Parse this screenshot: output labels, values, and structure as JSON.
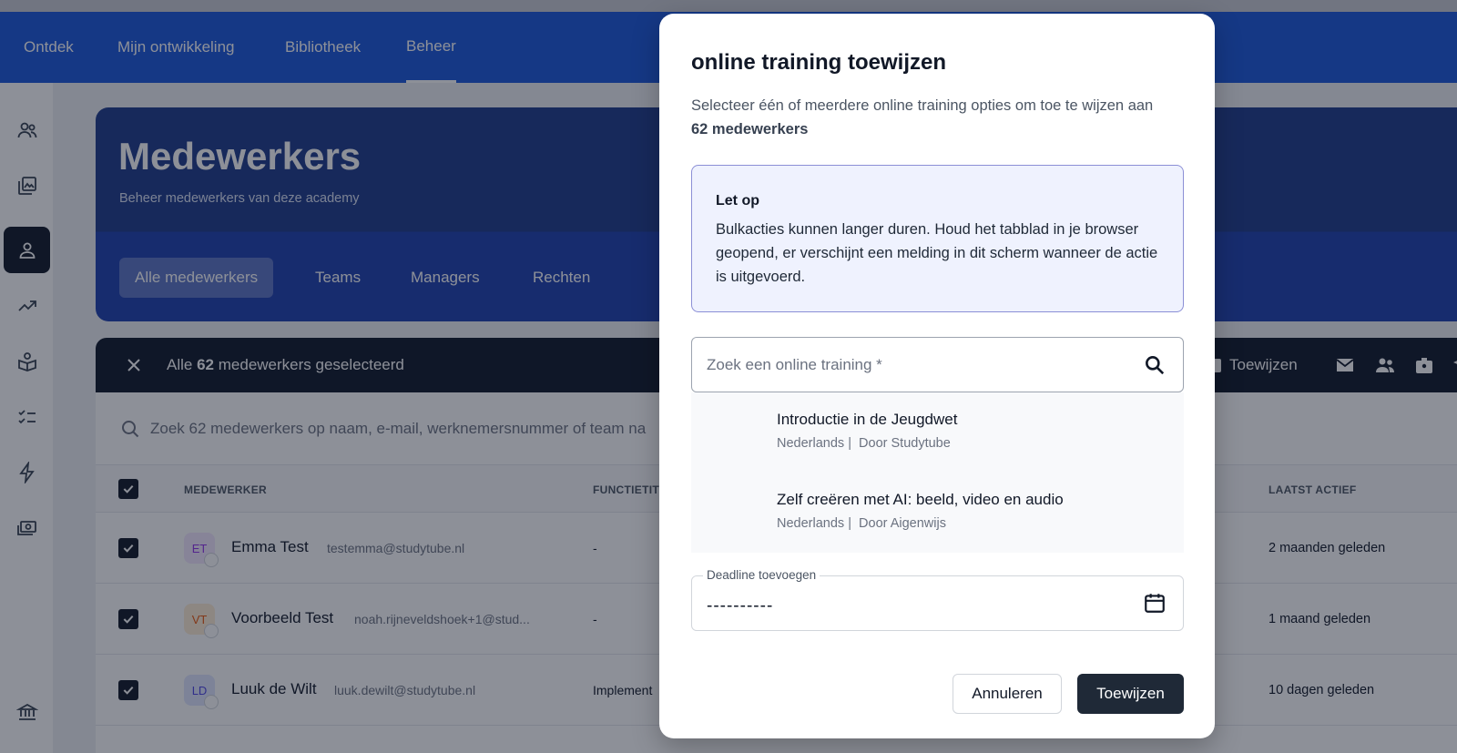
{
  "topnav": {
    "items": [
      "Ontdek",
      "Mijn ontwikkeling",
      "Bibliotheek",
      "Beheer"
    ],
    "active_index": 3
  },
  "sidebar": {
    "icons": [
      "users-icon",
      "library-icon",
      "person-icon",
      "trending-icon",
      "learning-icon",
      "checklist-icon",
      "bolt-icon",
      "money-icon",
      "bank-icon"
    ],
    "active": "person-icon"
  },
  "header": {
    "title": "Medewerkers",
    "subtitle": "Beheer medewerkers van deze academy",
    "tabs": [
      "Alle medewerkers",
      "Teams",
      "Managers",
      "Rechten"
    ],
    "active_tab": 0
  },
  "selection_bar": {
    "prefix": "Alle",
    "count": "62",
    "suffix": "medewerkers geselecteerd",
    "assign_label": "Toewijzen"
  },
  "table": {
    "search_placeholder": "Zoek 62 medewerkers op naam, e-mail, werknemersnummer of team na",
    "columns": {
      "employee": "MEDEWERKER",
      "function": "FUNCTIETIT",
      "last_active": "LAATST ACTIEF"
    },
    "rows": [
      {
        "initials": "ET",
        "name": "Emma Test",
        "email": "testemma@studytube.nl",
        "function": "-",
        "last_active": "2 maanden geleden",
        "avatar_bg": "#f3e8ff",
        "avatar_fg": "#9333ea"
      },
      {
        "initials": "VT",
        "name": "Voorbeeld Test",
        "email": "noah.rijneveldshoek+1@stud...",
        "function": "-",
        "last_active": "1 maand geleden",
        "avatar_bg": "#ffedd5",
        "avatar_fg": "#ea580c"
      },
      {
        "initials": "LD",
        "name": "Luuk de Wilt",
        "email": "luuk.dewilt@studytube.nl",
        "function": "Implement",
        "last_active": "10 dagen geleden",
        "avatar_bg": "#e0e7ff",
        "avatar_fg": "#4f46e5"
      }
    ]
  },
  "modal": {
    "title": "online training toewijzen",
    "description": "Selecteer één of meerdere online training opties om toe te wijzen aan",
    "description_bold": "62 medewerkers",
    "notice": {
      "title": "Let op",
      "body": "Bulkacties kunnen langer duren. Houd het tabblad in je browser geopend, er verschijnt een melding in dit scherm wanneer de actie is uitgevoerd."
    },
    "search": {
      "placeholder": "Zoek een online training *",
      "value": ""
    },
    "options": [
      {
        "title": "Introductie in de Jeugdwet",
        "language": "Nederlands",
        "provider": "Door Studytube"
      },
      {
        "title": "Zelf creëren met AI: beeld, video en audio",
        "language": "Nederlands",
        "provider": "Door Aigenwijs"
      }
    ],
    "deadline": {
      "label": "Deadline toevoegen",
      "value": "--‐--‐----"
    },
    "buttons": {
      "cancel": "Annuleren",
      "assign": "Toewijzen"
    }
  },
  "colors": {
    "nav_blue": "#1a56db",
    "hero_navy": "#1e3a8a",
    "selection_bar": "#0f172a",
    "primary_button": "#1f2937",
    "notice_bg": "#eff2fe",
    "notice_border": "#8b8fd6"
  }
}
